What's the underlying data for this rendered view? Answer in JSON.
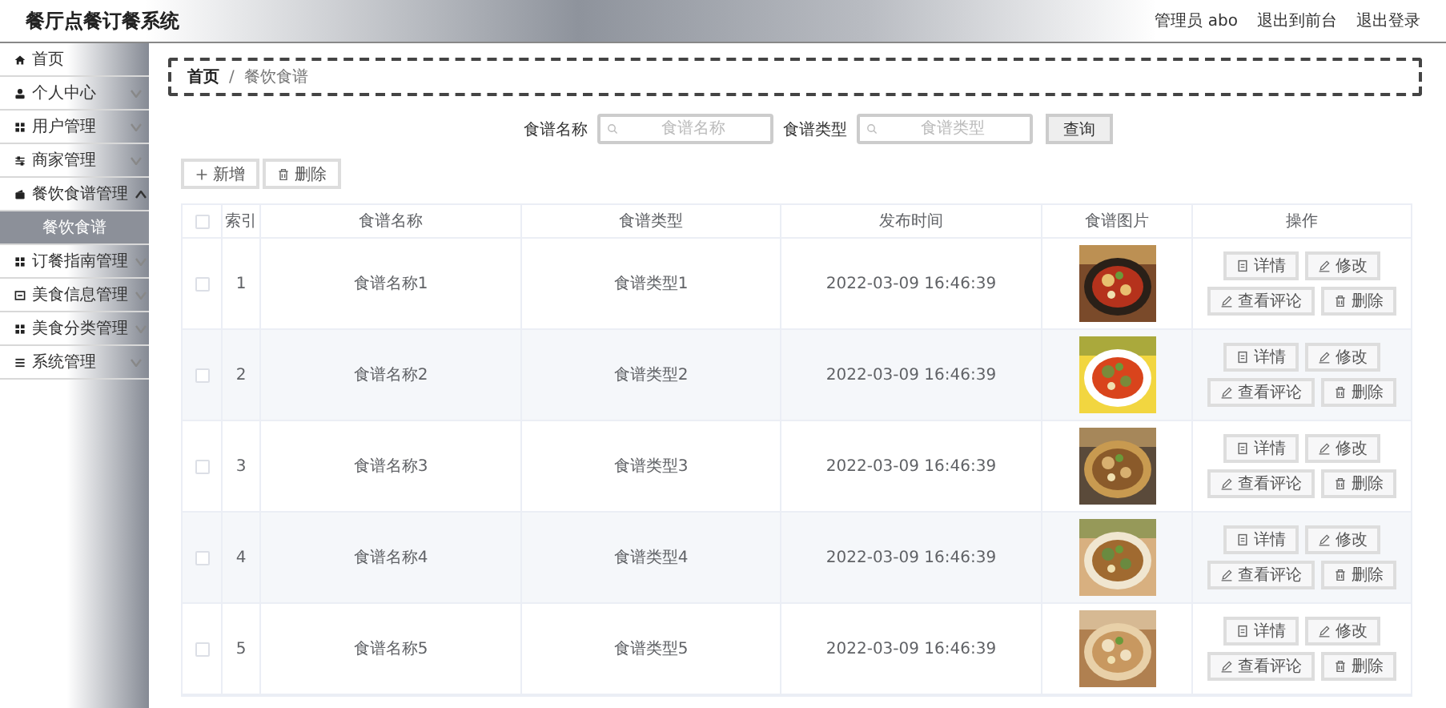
{
  "header": {
    "title": "餐厅点餐订餐系统",
    "user": "管理员 abo",
    "links": [
      "退出到前台",
      "退出登录"
    ]
  },
  "sidebar": {
    "items": [
      {
        "kind": "link",
        "label": "首页"
      },
      {
        "kind": "group",
        "label": "个人中心",
        "expanded": false
      },
      {
        "kind": "group",
        "label": "用户管理",
        "expanded": false
      },
      {
        "kind": "group",
        "label": "商家管理",
        "expanded": false
      },
      {
        "kind": "group",
        "label": "餐饮食谱管理",
        "expanded": true,
        "children": [
          {
            "label": "餐饮食谱",
            "selected": true
          }
        ]
      },
      {
        "kind": "group",
        "label": "订餐指南管理",
        "expanded": false
      },
      {
        "kind": "group",
        "label": "美食信息管理",
        "expanded": false
      },
      {
        "kind": "group",
        "label": "美食分类管理",
        "expanded": false
      },
      {
        "kind": "group",
        "label": "系统管理",
        "expanded": false
      }
    ]
  },
  "breadcrumb": [
    "首页",
    "/",
    "餐饮食谱"
  ],
  "search": {
    "fields": [
      {
        "label": "食谱名称",
        "placeholder": "食谱名称"
      },
      {
        "label": "食谱类型",
        "placeholder": "食谱类型"
      }
    ],
    "button": "查询"
  },
  "toolbar": [
    {
      "kind": "add",
      "label": "新增"
    },
    {
      "kind": "delete",
      "label": "删除"
    }
  ],
  "table": {
    "all_checked": false,
    "columns": [
      "索引",
      "食谱名称",
      "食谱类型",
      "发布时间",
      "食谱图片",
      "操作"
    ],
    "rows": [
      {
        "checked": false,
        "index": "1",
        "name": "食谱名称1",
        "type": "食谱类型1",
        "time": "2022-03-09 16:46:39",
        "image": {
          "kind": "picture"
        },
        "actions": [
          {
            "kind": "detail",
            "label": "详情"
          },
          {
            "kind": "edit",
            "label": "修改"
          },
          {
            "kind": "comments",
            "label": "查看评论"
          },
          {
            "kind": "delete",
            "label": "删除"
          }
        ]
      },
      {
        "checked": false,
        "index": "2",
        "name": "食谱名称2",
        "type": "食谱类型2",
        "time": "2022-03-09 16:46:39",
        "image": {
          "kind": "picture"
        },
        "actions": [
          {
            "kind": "detail",
            "label": "详情"
          },
          {
            "kind": "edit",
            "label": "修改"
          },
          {
            "kind": "comments",
            "label": "查看评论"
          },
          {
            "kind": "delete",
            "label": "删除"
          }
        ]
      },
      {
        "checked": false,
        "index": "3",
        "name": "食谱名称3",
        "type": "食谱类型3",
        "time": "2022-03-09 16:46:39",
        "image": {
          "kind": "picture"
        },
        "actions": [
          {
            "kind": "detail",
            "label": "详情"
          },
          {
            "kind": "edit",
            "label": "修改"
          },
          {
            "kind": "comments",
            "label": "查看评论"
          },
          {
            "kind": "delete",
            "label": "删除"
          }
        ]
      },
      {
        "checked": false,
        "index": "4",
        "name": "食谱名称4",
        "type": "食谱类型4",
        "time": "2022-03-09 16:46:39",
        "image": {
          "kind": "picture"
        },
        "actions": [
          {
            "kind": "detail",
            "label": "详情"
          },
          {
            "kind": "edit",
            "label": "修改"
          },
          {
            "kind": "comments",
            "label": "查看评论"
          },
          {
            "kind": "delete",
            "label": "删除"
          }
        ]
      },
      {
        "checked": false,
        "index": "5",
        "name": "食谱名称5",
        "type": "食谱类型5",
        "time": "2022-03-09 16:46:39",
        "image": {
          "kind": "picture"
        },
        "actions": [
          {
            "kind": "detail",
            "label": "详情"
          },
          {
            "kind": "edit",
            "label": "修改"
          },
          {
            "kind": "comments",
            "label": "查看评论"
          },
          {
            "kind": "delete",
            "label": "删除"
          }
        ]
      }
    ]
  }
}
